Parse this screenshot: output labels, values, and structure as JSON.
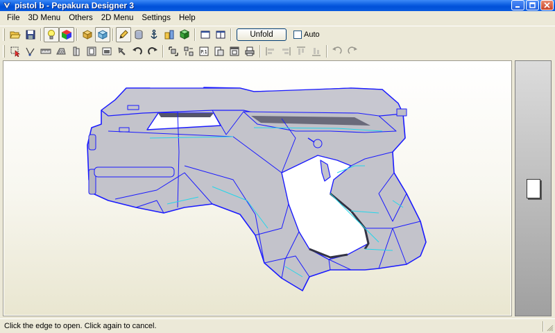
{
  "window": {
    "title": "pistol b - Pepakura Designer 3",
    "icon": "pepakura-app-icon",
    "buttons": [
      "minimize-icon",
      "maximize-icon",
      "close-icon"
    ]
  },
  "menu": {
    "items": [
      {
        "label": "File"
      },
      {
        "label": "3D Menu"
      },
      {
        "label": "Others"
      },
      {
        "label": "2D Menu"
      },
      {
        "label": "Settings"
      },
      {
        "label": "Help"
      }
    ]
  },
  "toolbar1": {
    "unfold_label": "Unfold",
    "auto_label": "Auto",
    "auto_checked": false,
    "icons": [
      "open-icon",
      "save-icon",
      "light-bulb-icon",
      "color-cube-icon",
      "box-icon",
      "box-selected-icon",
      "pencil-icon",
      "cylinder-icon",
      "anchor-icon",
      "parts-icon",
      "cube-green-icon",
      "single-view-icon",
      "dual-view-icon"
    ]
  },
  "toolbar2": {
    "page_label": "P.1",
    "icons": [
      "select-icon",
      "edge-tool-icon",
      "ruler-icon",
      "flap-icon",
      "join-icon",
      "part-icon",
      "image-icon",
      "move-icon",
      "rotate-left-icon",
      "rotate-right-icon",
      "arrange-icon",
      "group-icon",
      "page-icon",
      "print-preview-icon",
      "window-icon",
      "print-icon",
      "align-left-icon",
      "align-right-icon",
      "align-top-icon",
      "align-bottom-icon",
      "rotate-90-left-icon",
      "rotate-90-right-icon"
    ]
  },
  "status": {
    "text": "Click the edge to open. Click again to cancel."
  },
  "colors": {
    "model_fill": "#c3c3cb",
    "edge_blue": "#1a1aff",
    "edge_cyan": "#22d6ea",
    "titlebar": "#0a5ce0"
  }
}
